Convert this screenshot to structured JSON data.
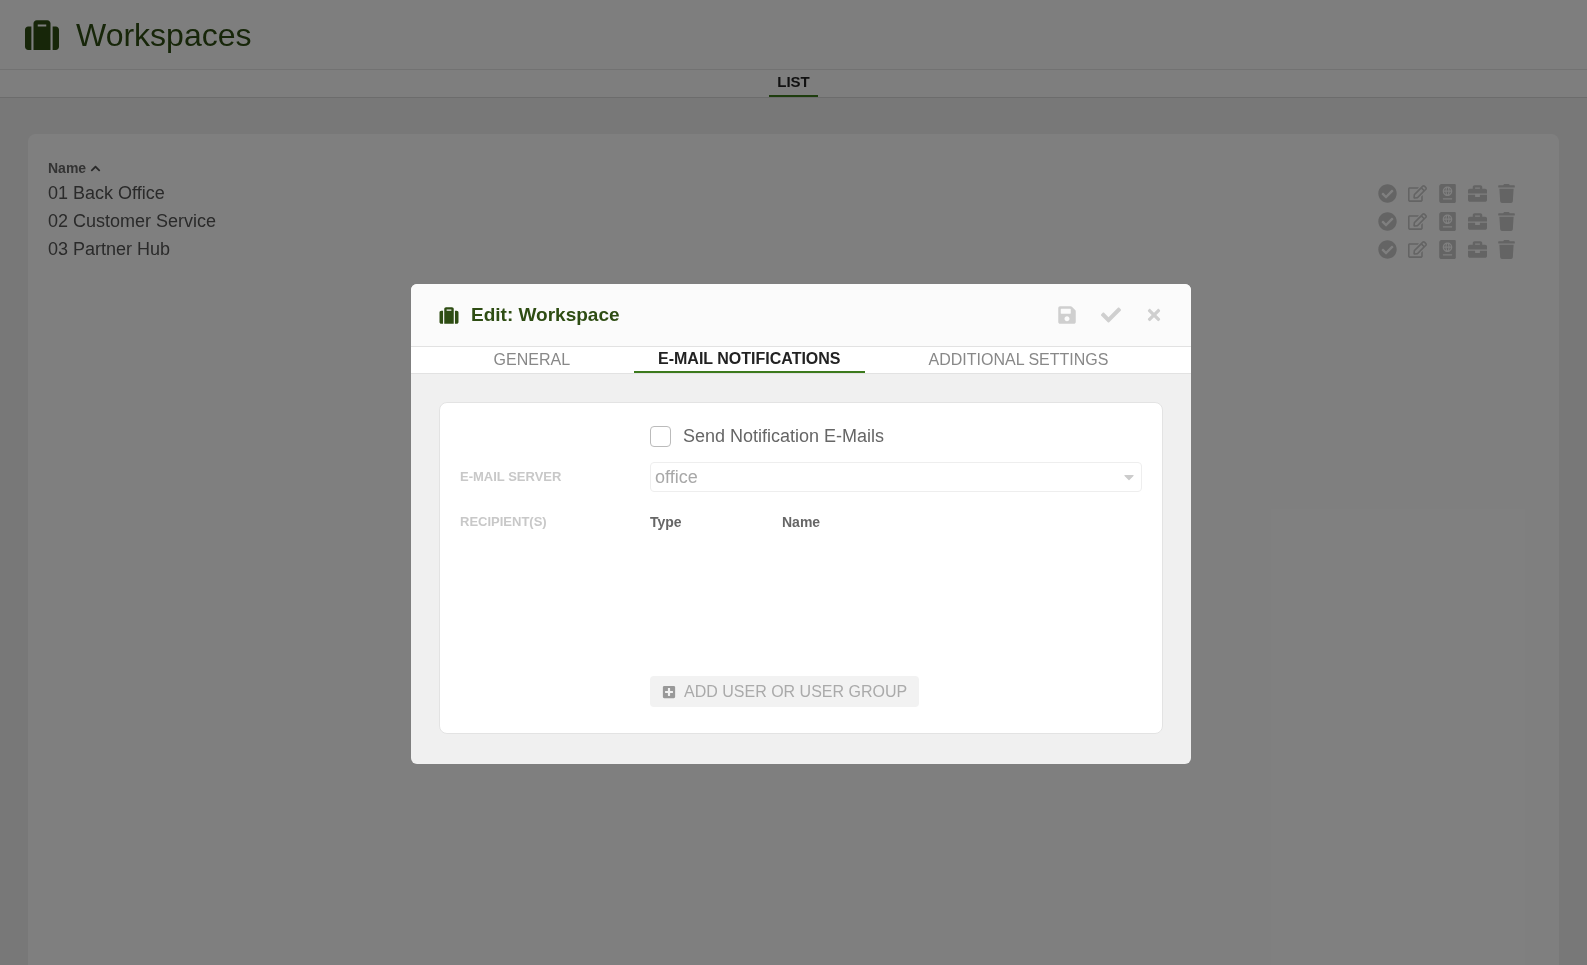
{
  "page": {
    "title": "Workspaces"
  },
  "page_tabs": [
    {
      "label": "LIST",
      "selected": true
    }
  ],
  "list": {
    "column": "Name",
    "sorted_ascending": true,
    "rows": [
      {
        "name": "01 Back Office"
      },
      {
        "name": "02 Customer Service"
      },
      {
        "name": "03 Partner Hub"
      }
    ]
  },
  "dialog": {
    "title": "Edit: Workspace",
    "tabs": [
      {
        "label": "GENERAL",
        "selected": false
      },
      {
        "label": "E-MAIL NOTIFICATIONS",
        "selected": true
      },
      {
        "label": "ADDITIONAL SETTINGS",
        "selected": false
      }
    ],
    "send_notifications": {
      "label": "Send Notification E-Mails",
      "checked": false
    },
    "email_server": {
      "label": "E-MAIL SERVER",
      "value": "office",
      "disabled": true
    },
    "recipients": {
      "label": "RECIPIENT(S)",
      "columns": [
        "Type",
        "Name"
      ]
    },
    "add_button": {
      "label": "ADD USER OR USER GROUP",
      "disabled": true
    }
  }
}
